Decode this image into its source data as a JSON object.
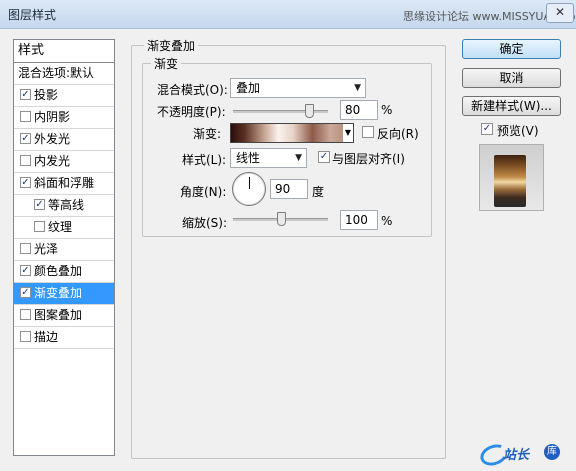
{
  "window": {
    "title": "图层样式",
    "watermark": "思缘设计论坛 www.MISSYUAN.com",
    "close_icon": "close-icon"
  },
  "style_list": {
    "header": "样式",
    "blend_options": "混合选项:默认",
    "items": [
      {
        "label": "投影",
        "checked": true
      },
      {
        "label": "内阴影",
        "checked": false
      },
      {
        "label": "外发光",
        "checked": true
      },
      {
        "label": "内发光",
        "checked": false
      },
      {
        "label": "斜面和浮雕",
        "checked": true
      },
      {
        "label": "等高线",
        "checked": true
      },
      {
        "label": "纹理",
        "checked": false
      },
      {
        "label": "光泽",
        "checked": false
      },
      {
        "label": "颜色叠加",
        "checked": true
      },
      {
        "label": "渐变叠加",
        "checked": true
      },
      {
        "label": "图案叠加",
        "checked": false
      },
      {
        "label": "描边",
        "checked": false
      }
    ]
  },
  "panel": {
    "group_title": "渐变叠加",
    "subgroup_title": "渐变",
    "blend_mode_label": "混合模式(O):",
    "blend_mode_value": "叠加",
    "opacity_label": "不透明度(P):",
    "opacity_value": "80",
    "opacity_unit": "%",
    "opacity_level": 0.8,
    "gradient_label": "渐变:",
    "reverse_label": "反向(R)",
    "reverse_checked": false,
    "style_label": "样式(L):",
    "style_value": "线性",
    "align_label": "与图层对齐(I)",
    "align_checked": true,
    "angle_label": "角度(N):",
    "angle_value": "90",
    "angle_unit": "度",
    "scale_label": "缩放(S):",
    "scale_value": "100",
    "scale_unit": "%",
    "scale_level": 0.5
  },
  "buttons": {
    "ok": "确定",
    "cancel": "取消",
    "new_style": "新建样式(W)...",
    "preview_label": "预览(V)",
    "preview_checked": true
  },
  "logo": {
    "text": "站长",
    "icon": "库"
  }
}
